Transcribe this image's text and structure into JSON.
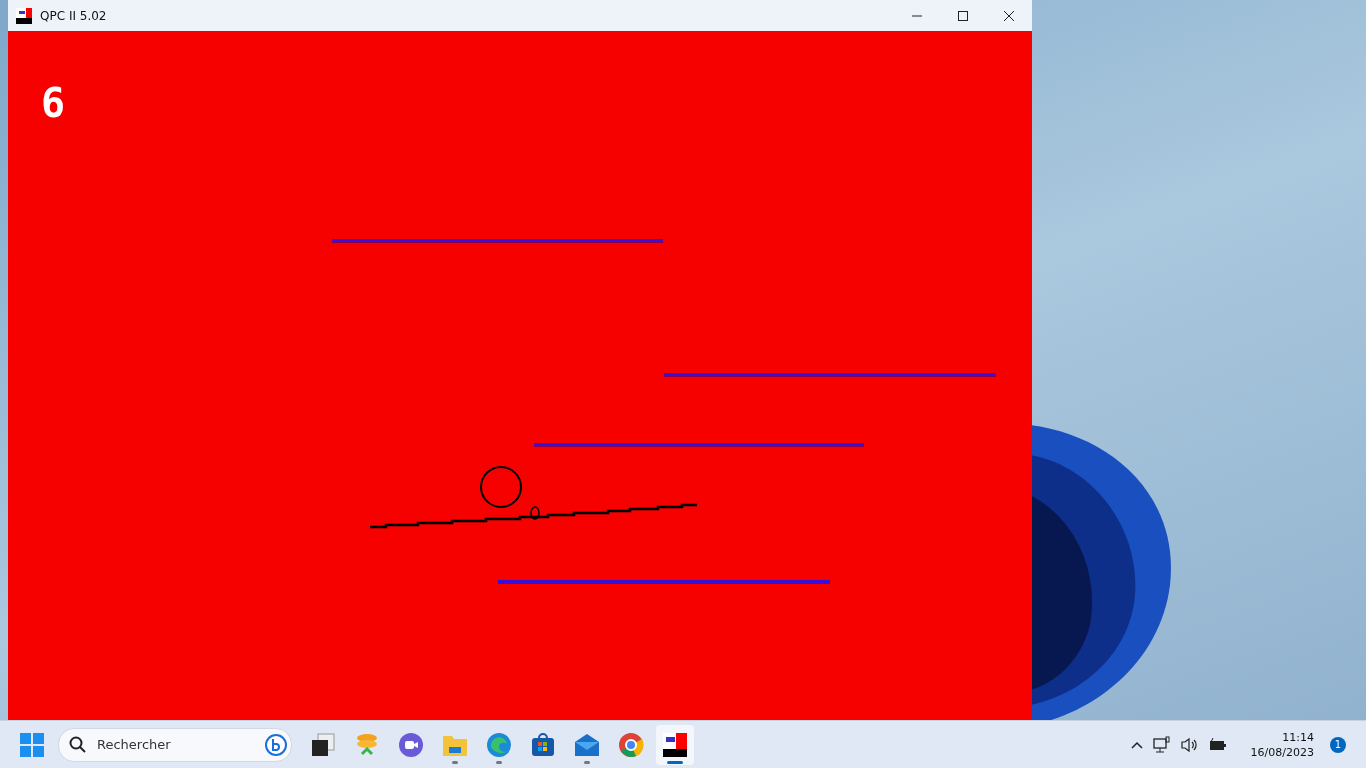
{
  "window": {
    "title": "QPC II 5.02"
  },
  "game": {
    "score": "6"
  },
  "taskbar": {
    "search": {
      "placeholder": "Rechercher"
    },
    "apps": [
      {
        "kind": "squares",
        "running": false,
        "selected": false
      },
      {
        "kind": "coins",
        "running": false,
        "selected": false
      },
      {
        "kind": "camera",
        "running": false,
        "selected": false
      },
      {
        "kind": "folder",
        "running": true,
        "selected": false
      },
      {
        "kind": "wave",
        "running": true,
        "selected": false
      },
      {
        "kind": "bag",
        "running": false,
        "selected": false
      },
      {
        "kind": "envelope",
        "running": true,
        "selected": false
      },
      {
        "kind": "ball",
        "running": false,
        "selected": false
      },
      {
        "kind": "emulator",
        "running": true,
        "selected": true
      }
    ],
    "time": "11:14",
    "date": "16/08/2023",
    "notifications": "1"
  }
}
